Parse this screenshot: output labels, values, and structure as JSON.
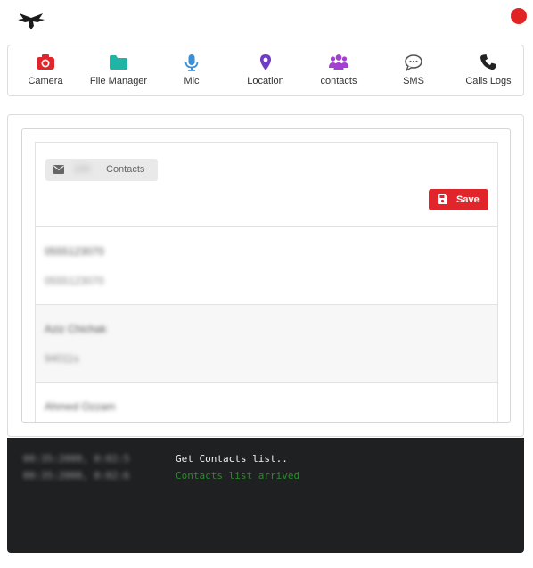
{
  "header": {
    "logo_icon": "eagle-logo-icon",
    "status_color": "#e02424"
  },
  "nav": {
    "items": [
      {
        "label": "Camera",
        "icon": "camera-icon",
        "color": "#e0262b"
      },
      {
        "label": "File Manager",
        "icon": "folder-icon",
        "color": "#1fb5a6"
      },
      {
        "label": "Mic",
        "icon": "microphone-icon",
        "color": "#3b8fd6"
      },
      {
        "label": "Location",
        "icon": "map-pin-icon",
        "color": "#6f3cc3"
      },
      {
        "label": "contacts",
        "icon": "users-icon",
        "color": "#a43fd1"
      },
      {
        "label": "SMS",
        "icon": "chat-bubble-icon",
        "color": "#555555"
      },
      {
        "label": "Calls Logs",
        "icon": "phone-icon",
        "color": "#222222"
      }
    ]
  },
  "contacts_panel": {
    "tag_icon": "envelope-icon",
    "count": "150",
    "tag_label": "Contacts",
    "save_label": "Save",
    "save_icon": "floppy-disk-icon",
    "contacts": [
      {
        "name": "0555123070",
        "number": "0555123070"
      },
      {
        "name": "Aziz Chichak",
        "number": "94011s"
      },
      {
        "name": "Ahmed Ozzam",
        "number": ""
      }
    ]
  },
  "console": {
    "lines": [
      {
        "timestamp": "00:35:2000, 0:02:5",
        "message": "Get Contacts list..",
        "color": "#f2f2f2"
      },
      {
        "timestamp": "00:35:2000, 0:02:6",
        "message": "Contacts list arrived",
        "color": "#2c8a2c"
      }
    ]
  }
}
